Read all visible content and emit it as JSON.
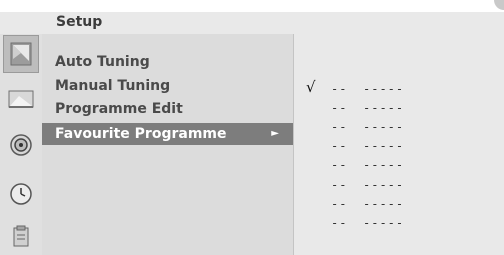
{
  "title": "Setup",
  "icons": [
    {
      "name": "setup-icon",
      "active": true
    },
    {
      "name": "picture-icon",
      "active": false
    },
    {
      "name": "sound-icon",
      "active": false
    },
    {
      "name": "time-icon",
      "active": false
    },
    {
      "name": "special-icon",
      "active": false
    }
  ],
  "menu": {
    "items": [
      {
        "label": "Auto Tuning"
      },
      {
        "label": "Manual Tuning"
      },
      {
        "label": "Programme Edit"
      },
      {
        "label": "Favourite Programme",
        "arrow": "►"
      }
    ],
    "selected_index": 3
  },
  "favourites": [
    {
      "check": "√",
      "number": "--",
      "name": "-----"
    },
    {
      "check": "",
      "number": "--",
      "name": "-----"
    },
    {
      "check": "",
      "number": "--",
      "name": "-----"
    },
    {
      "check": "",
      "number": "--",
      "name": "-----"
    },
    {
      "check": "",
      "number": "--",
      "name": "-----"
    },
    {
      "check": "",
      "number": "--",
      "name": "-----"
    },
    {
      "check": "",
      "number": "--",
      "name": "-----"
    },
    {
      "check": "",
      "number": "--",
      "name": "-----"
    }
  ],
  "colors": {
    "selected_bg": "#7d7d7d",
    "menu_bg": "#dcdcdc",
    "sub_bg": "#e9e9e9"
  }
}
